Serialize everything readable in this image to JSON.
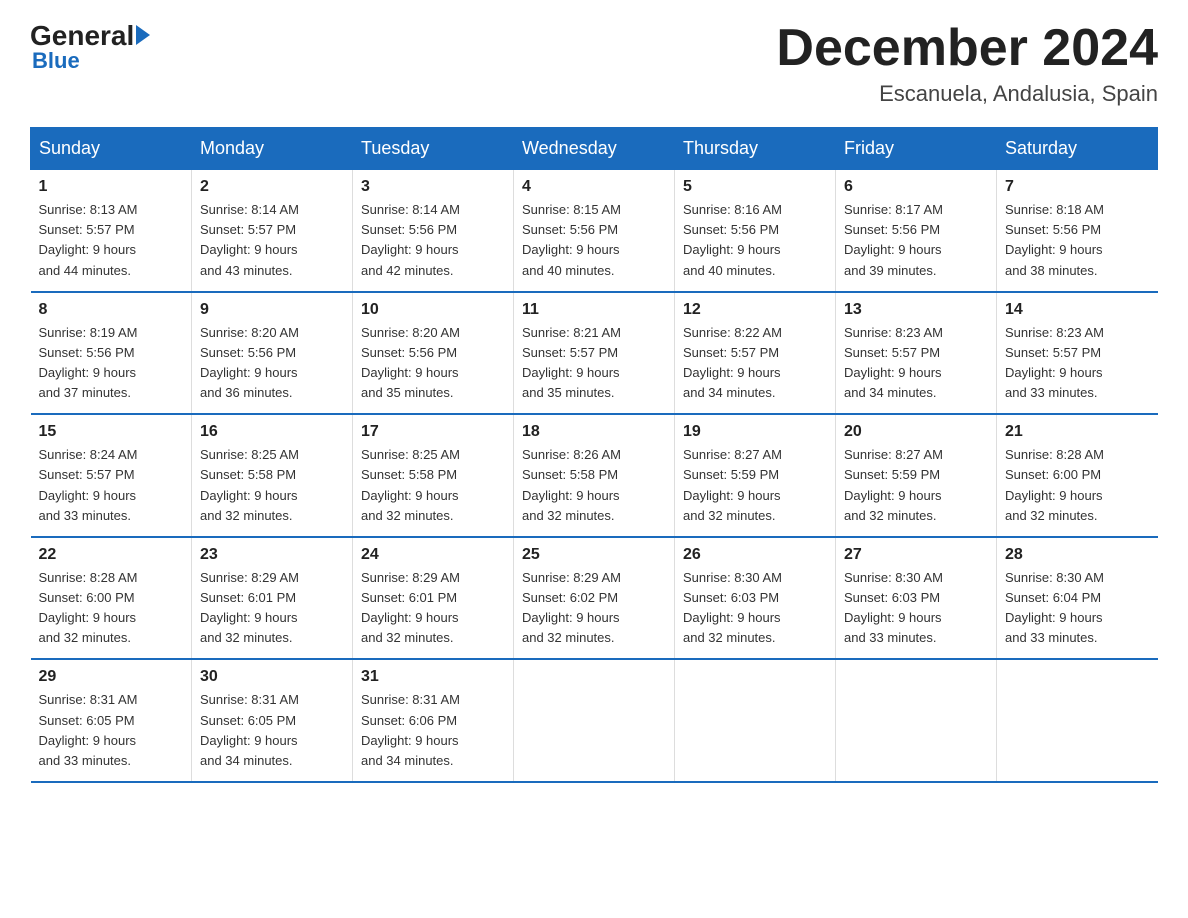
{
  "logo": {
    "general": "General",
    "blue": "Blue",
    "arrow": "▶"
  },
  "header": {
    "month_title": "December 2024",
    "location": "Escanuela, Andalusia, Spain"
  },
  "days_of_week": [
    "Sunday",
    "Monday",
    "Tuesday",
    "Wednesday",
    "Thursday",
    "Friday",
    "Saturday"
  ],
  "weeks": [
    [
      {
        "day": "1",
        "sunrise": "8:13 AM",
        "sunset": "5:57 PM",
        "daylight": "9 hours and 44 minutes."
      },
      {
        "day": "2",
        "sunrise": "8:14 AM",
        "sunset": "5:57 PM",
        "daylight": "9 hours and 43 minutes."
      },
      {
        "day": "3",
        "sunrise": "8:14 AM",
        "sunset": "5:56 PM",
        "daylight": "9 hours and 42 minutes."
      },
      {
        "day": "4",
        "sunrise": "8:15 AM",
        "sunset": "5:56 PM",
        "daylight": "9 hours and 40 minutes."
      },
      {
        "day": "5",
        "sunrise": "8:16 AM",
        "sunset": "5:56 PM",
        "daylight": "9 hours and 40 minutes."
      },
      {
        "day": "6",
        "sunrise": "8:17 AM",
        "sunset": "5:56 PM",
        "daylight": "9 hours and 39 minutes."
      },
      {
        "day": "7",
        "sunrise": "8:18 AM",
        "sunset": "5:56 PM",
        "daylight": "9 hours and 38 minutes."
      }
    ],
    [
      {
        "day": "8",
        "sunrise": "8:19 AM",
        "sunset": "5:56 PM",
        "daylight": "9 hours and 37 minutes."
      },
      {
        "day": "9",
        "sunrise": "8:20 AM",
        "sunset": "5:56 PM",
        "daylight": "9 hours and 36 minutes."
      },
      {
        "day": "10",
        "sunrise": "8:20 AM",
        "sunset": "5:56 PM",
        "daylight": "9 hours and 35 minutes."
      },
      {
        "day": "11",
        "sunrise": "8:21 AM",
        "sunset": "5:57 PM",
        "daylight": "9 hours and 35 minutes."
      },
      {
        "day": "12",
        "sunrise": "8:22 AM",
        "sunset": "5:57 PM",
        "daylight": "9 hours and 34 minutes."
      },
      {
        "day": "13",
        "sunrise": "8:23 AM",
        "sunset": "5:57 PM",
        "daylight": "9 hours and 34 minutes."
      },
      {
        "day": "14",
        "sunrise": "8:23 AM",
        "sunset": "5:57 PM",
        "daylight": "9 hours and 33 minutes."
      }
    ],
    [
      {
        "day": "15",
        "sunrise": "8:24 AM",
        "sunset": "5:57 PM",
        "daylight": "9 hours and 33 minutes."
      },
      {
        "day": "16",
        "sunrise": "8:25 AM",
        "sunset": "5:58 PM",
        "daylight": "9 hours and 32 minutes."
      },
      {
        "day": "17",
        "sunrise": "8:25 AM",
        "sunset": "5:58 PM",
        "daylight": "9 hours and 32 minutes."
      },
      {
        "day": "18",
        "sunrise": "8:26 AM",
        "sunset": "5:58 PM",
        "daylight": "9 hours and 32 minutes."
      },
      {
        "day": "19",
        "sunrise": "8:27 AM",
        "sunset": "5:59 PM",
        "daylight": "9 hours and 32 minutes."
      },
      {
        "day": "20",
        "sunrise": "8:27 AM",
        "sunset": "5:59 PM",
        "daylight": "9 hours and 32 minutes."
      },
      {
        "day": "21",
        "sunrise": "8:28 AM",
        "sunset": "6:00 PM",
        "daylight": "9 hours and 32 minutes."
      }
    ],
    [
      {
        "day": "22",
        "sunrise": "8:28 AM",
        "sunset": "6:00 PM",
        "daylight": "9 hours and 32 minutes."
      },
      {
        "day": "23",
        "sunrise": "8:29 AM",
        "sunset": "6:01 PM",
        "daylight": "9 hours and 32 minutes."
      },
      {
        "day": "24",
        "sunrise": "8:29 AM",
        "sunset": "6:01 PM",
        "daylight": "9 hours and 32 minutes."
      },
      {
        "day": "25",
        "sunrise": "8:29 AM",
        "sunset": "6:02 PM",
        "daylight": "9 hours and 32 minutes."
      },
      {
        "day": "26",
        "sunrise": "8:30 AM",
        "sunset": "6:03 PM",
        "daylight": "9 hours and 32 minutes."
      },
      {
        "day": "27",
        "sunrise": "8:30 AM",
        "sunset": "6:03 PM",
        "daylight": "9 hours and 33 minutes."
      },
      {
        "day": "28",
        "sunrise": "8:30 AM",
        "sunset": "6:04 PM",
        "daylight": "9 hours and 33 minutes."
      }
    ],
    [
      {
        "day": "29",
        "sunrise": "8:31 AM",
        "sunset": "6:05 PM",
        "daylight": "9 hours and 33 minutes."
      },
      {
        "day": "30",
        "sunrise": "8:31 AM",
        "sunset": "6:05 PM",
        "daylight": "9 hours and 34 minutes."
      },
      {
        "day": "31",
        "sunrise": "8:31 AM",
        "sunset": "6:06 PM",
        "daylight": "9 hours and 34 minutes."
      },
      null,
      null,
      null,
      null
    ]
  ],
  "labels": {
    "sunrise": "Sunrise:",
    "sunset": "Sunset:",
    "daylight": "Daylight:"
  }
}
